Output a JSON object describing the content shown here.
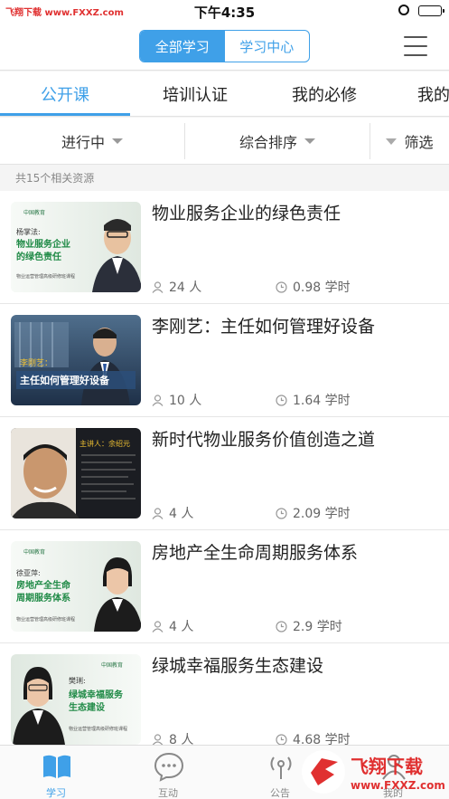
{
  "status_bar": {
    "watermark": "飞翔下载 www.FXXZ.com",
    "time": "下午4:35"
  },
  "header": {
    "segments": [
      "全部学习",
      "学习中心"
    ],
    "active_segment": 0
  },
  "tabs": [
    "公开课",
    "培训认证",
    "我的必修",
    "我的"
  ],
  "filters": {
    "status": "进行中",
    "sort": "综合排序",
    "filter": "筛选"
  },
  "result_count": "共15个相关资源",
  "courses": [
    {
      "title": "物业服务企业的绿色责任",
      "people": "24 人",
      "hours": "0.98 学时",
      "thumb": {
        "brand": "中国教育",
        "speaker": "杨掌法:",
        "heading": "物业服务企业的绿色责任",
        "footer": "物业运营管理高级研修班课程"
      }
    },
    {
      "title": "李刚艺：主任如何管理好设备",
      "people": "10 人",
      "hours": "1.64 学时",
      "thumb": {
        "speaker": "李刚艺：",
        "heading": "主任如何管理好设备"
      }
    },
    {
      "title": "新时代物业服务价值创造之道",
      "people": "4 人",
      "hours": "2.09 学时",
      "thumb": {
        "speaker": "主讲人：余绍元"
      }
    },
    {
      "title": "房地产全生命周期服务体系",
      "people": "4 人",
      "hours": "2.9 学时",
      "thumb": {
        "brand": "中国教育",
        "speaker": "徐亚萍:",
        "heading": "房地产全生命周期服务体系",
        "footer": "物业运营管理高级研修班课程"
      }
    },
    {
      "title": "绿城幸福服务生态建设",
      "people": "8 人",
      "hours": "4.68 学时",
      "thumb": {
        "brand": "中国教育",
        "speaker": "樊琍:",
        "heading": "绿城幸福服务生态建设",
        "footer": "物业运营管理高级研修班课程"
      }
    }
  ],
  "bottom_nav": [
    {
      "label": "学习",
      "icon": "book-icon"
    },
    {
      "label": "互动",
      "icon": "chat-icon"
    },
    {
      "label": "公告",
      "icon": "broadcast-icon"
    },
    {
      "label": "我的",
      "icon": "user-icon"
    }
  ],
  "overlay_watermark": {
    "text1": "飞翔下载",
    "text2": "www.FXXZ.com"
  },
  "colors": {
    "accent": "#3fa0e8",
    "green_banner": "#1f8a46"
  }
}
